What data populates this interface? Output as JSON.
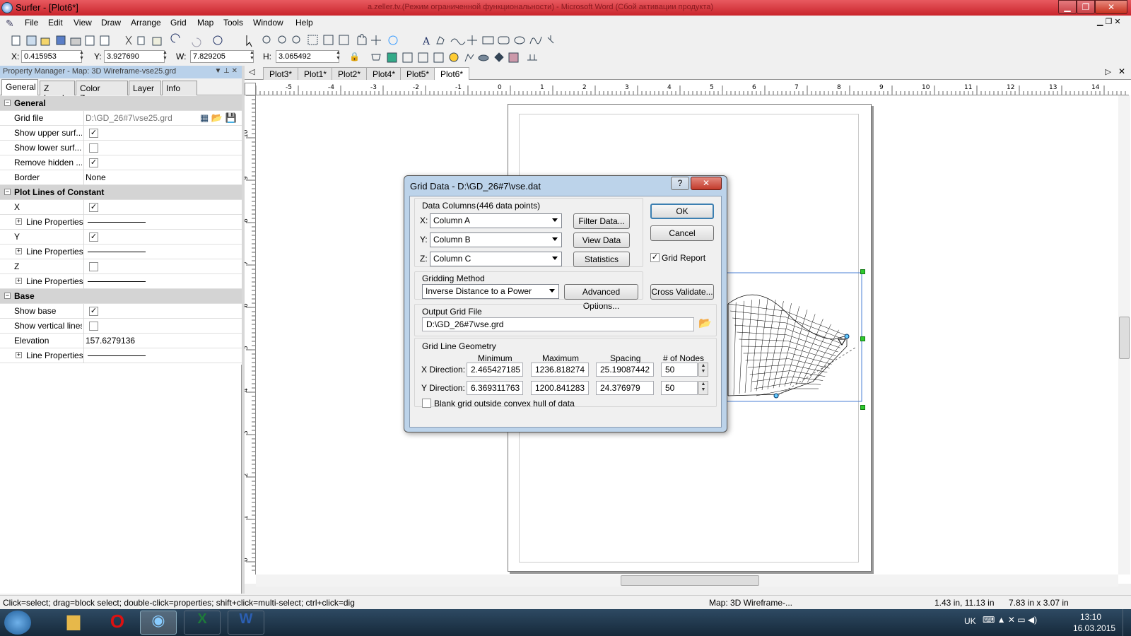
{
  "window": {
    "title": "Surfer - [Plot6*]",
    "background_title": "a.zeller.tv.(Режим ограниченной функциональности) - Microsoft Word (Сбой активации продукта)"
  },
  "menu": [
    "File",
    "Edit",
    "View",
    "Draw",
    "Arrange",
    "Grid",
    "Map",
    "Tools",
    "Window",
    "Help"
  ],
  "coords": {
    "x_label": "X:",
    "x": "0.415953",
    "y_label": "Y:",
    "y": "3.927690",
    "w_label": "W:",
    "w": "7.829205",
    "h_label": "H:",
    "h": "3.065492"
  },
  "property_manager": {
    "title": "Property Manager - Map: 3D Wireframe-vse25.grd",
    "tabs": [
      "General",
      "Z Levels",
      "Color Zones",
      "Layer",
      "Info"
    ],
    "rows": [
      {
        "type": "section",
        "label": "General"
      },
      {
        "type": "text",
        "label": "Grid file",
        "value": "D:\\GD_26#7\\vse25.grd"
      },
      {
        "type": "check",
        "label": "Show upper surf...",
        "checked": true
      },
      {
        "type": "check",
        "label": "Show lower surf...",
        "checked": false
      },
      {
        "type": "check",
        "label": "Remove hidden ...",
        "checked": true
      },
      {
        "type": "text",
        "label": "Border",
        "value": "None"
      },
      {
        "type": "section",
        "label": "Plot Lines of Constant"
      },
      {
        "type": "check",
        "label": "X",
        "checked": true
      },
      {
        "type": "line",
        "label": "Line Properties"
      },
      {
        "type": "check",
        "label": "Y",
        "checked": true
      },
      {
        "type": "line",
        "label": "Line Properties"
      },
      {
        "type": "check",
        "label": "Z",
        "checked": false
      },
      {
        "type": "line",
        "label": "Line Properties"
      },
      {
        "type": "section",
        "label": "Base"
      },
      {
        "type": "check",
        "label": "Show base",
        "checked": true
      },
      {
        "type": "check",
        "label": "Show vertical lines",
        "checked": false
      },
      {
        "type": "text",
        "label": "Elevation",
        "value": "157.6279136"
      },
      {
        "type": "line",
        "label": "Line Properties"
      }
    ]
  },
  "doc_tabs": [
    "Plot3*",
    "Plot1*",
    "Plot2*",
    "Plot4*",
    "Plot5*",
    "Plot6*"
  ],
  "active_doc_tab": "Plot6*",
  "ruler": {
    "h": [
      "-5",
      "-4",
      "-3",
      "-2",
      "-1",
      "0",
      "1",
      "2",
      "3",
      "4",
      "5",
      "6",
      "7",
      "8",
      "9",
      "10",
      "11",
      "12",
      "13",
      "14"
    ],
    "v": [
      "10",
      "9",
      "8",
      "7",
      "6",
      "5",
      "4",
      "3",
      "2",
      "1",
      "0"
    ]
  },
  "dialog": {
    "title": "Grid Data - D:\\GD_26#7\\vse.dat",
    "help_glyph": "?",
    "close_glyph": "✕",
    "data_columns_label": "Data Columns",
    "data_points": "(446 data points)",
    "x_label": "X:",
    "x_col": "Column A",
    "y_label": "Y:",
    "y_col": "Column B",
    "z_label": "Z:",
    "z_col": "Column C",
    "filter_btn": "Filter Data...",
    "view_btn": "View Data",
    "stats_btn": "Statistics",
    "ok_btn": "OK",
    "cancel_btn": "Cancel",
    "grid_report": "Grid Report",
    "grid_report_checked": true,
    "gridding_method_label": "Gridding Method",
    "gridding_method": "Inverse Distance to a Power",
    "advanced_btn": "Advanced Options...",
    "cross_btn": "Cross Validate...",
    "output_label": "Output Grid File",
    "output_file": "D:\\GD_26#7\\vse.grd",
    "geometry_label": "Grid Line Geometry",
    "col_min": "Minimum",
    "col_max": "Maximum",
    "col_spacing": "Spacing",
    "col_nodes": "# of Nodes",
    "x_dir_label": "X Direction:",
    "x_min": "2.465427185",
    "x_max": "1236.818274",
    "x_spacing": "25.19087442",
    "x_nodes": "50",
    "y_dir_label": "Y Direction:",
    "y_min": "6.369311763",
    "y_max": "1200.841283",
    "y_spacing": "24.376979",
    "y_nodes": "50",
    "blank_label": "Blank grid outside convex hull of data",
    "blank_checked": false
  },
  "status": {
    "hint": "Click=select; drag=block select; double-click=properties; shift+click=multi-select; ctrl+click=dig",
    "object": "Map: 3D Wireframe-...",
    "position": "1.43 in, 11.13 in",
    "size": "7.83 in x 3.07 in"
  },
  "tray": {
    "lang": "UK",
    "time": "13:10",
    "date": "16.03.2015"
  }
}
